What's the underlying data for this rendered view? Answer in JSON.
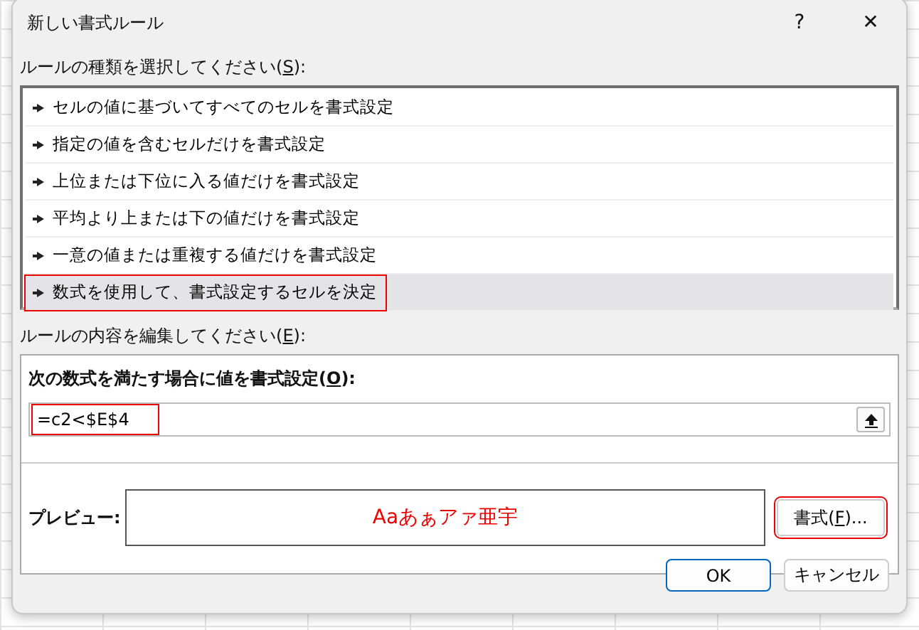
{
  "window": {
    "title": "新しい書式ルール",
    "help": "?",
    "close": "✕"
  },
  "rule_type_label": {
    "before": "ルールの種類を選択してください(",
    "key": "S",
    "after": "):"
  },
  "rule_types": [
    {
      "label": "セルの値に基づいてすべてのセルを書式設定",
      "selected": false,
      "highlighted": false
    },
    {
      "label": "指定の値を含むセルだけを書式設定",
      "selected": false,
      "highlighted": false
    },
    {
      "label": "上位または下位に入る値だけを書式設定",
      "selected": false,
      "highlighted": false
    },
    {
      "label": "平均より上または下の値だけを書式設定",
      "selected": false,
      "highlighted": false
    },
    {
      "label": "一意の値または重複する値だけを書式設定",
      "selected": false,
      "highlighted": false
    },
    {
      "label": "数式を使用して、書式設定するセルを決定",
      "selected": true,
      "highlighted": true
    }
  ],
  "edit_label": {
    "before": "ルールの内容を編集してください(",
    "key": "E",
    "after": "):"
  },
  "formula_label": {
    "before": "次の数式を満たす場合に値を書式設定(",
    "key": "O",
    "after": "):"
  },
  "formula": {
    "value": "=c2<$E$4",
    "highlighted": true
  },
  "preview": {
    "label": "プレビュー:",
    "sample": "Aaあぁアァ亜宇"
  },
  "format_button": {
    "before": "書式(",
    "key": "F",
    "after": ")...",
    "highlighted": true
  },
  "buttons": [
    {
      "label": "OK",
      "default": true
    },
    {
      "label": "キャンセル",
      "default": false
    }
  ]
}
